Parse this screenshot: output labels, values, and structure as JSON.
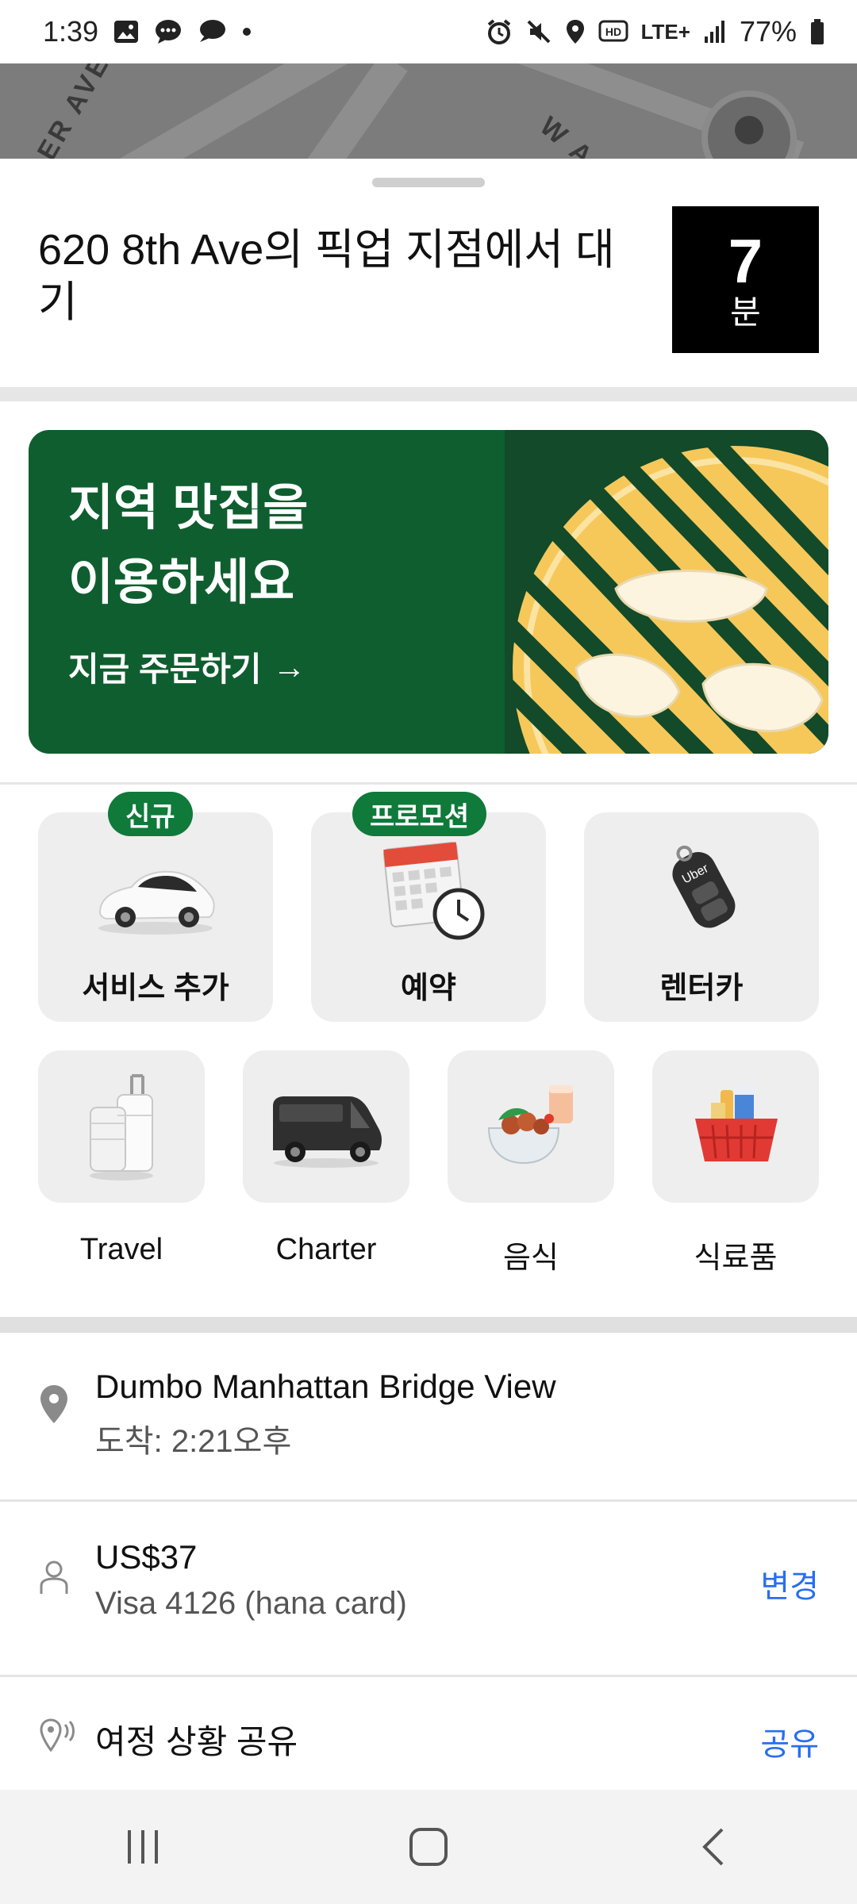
{
  "status_bar": {
    "time": "1:39",
    "network": "LTE+",
    "battery": "77%"
  },
  "map": {
    "street_label_1": "ER AVE",
    "street_label_2": "W A"
  },
  "pickup": {
    "title": "620 8th Ave의 픽업 지점에서 대기",
    "eta_value": "7",
    "eta_unit": "분"
  },
  "promo": {
    "title_line1": "지역 맛집을",
    "title_line2": "이용하세요",
    "cta": "지금 주문하기",
    "cta_arrow": "→",
    "accent_color": "#0f5e2f"
  },
  "services_top": [
    {
      "label": "서비스 추가",
      "badge": "신규",
      "icon": "car-icon"
    },
    {
      "label": "예약",
      "badge": "프로모션",
      "icon": "calendar-clock-icon"
    },
    {
      "label": "렌터카",
      "badge": "",
      "icon": "car-key-icon"
    }
  ],
  "services_bottom": [
    {
      "label": "Travel",
      "icon": "luggage-icon"
    },
    {
      "label": "Charter",
      "icon": "van-icon"
    },
    {
      "label": "음식",
      "icon": "food-bowl-icon"
    },
    {
      "label": "식료품",
      "icon": "grocery-basket-icon"
    }
  ],
  "trip": {
    "destination": {
      "name": "Dumbo Manhattan Bridge View",
      "arrival": "도착: 2:21오후",
      "icon": "location-pin-icon"
    },
    "payment": {
      "amount": "US$37",
      "card": "Visa 4126 (hana card)",
      "action": "변경",
      "icon": "person-icon"
    },
    "share": {
      "label": "여정 상황 공유",
      "action": "공유",
      "icon": "share-location-icon"
    }
  },
  "colors": {
    "badge_green": "#0f7a3a",
    "link_blue": "#276ef1"
  }
}
